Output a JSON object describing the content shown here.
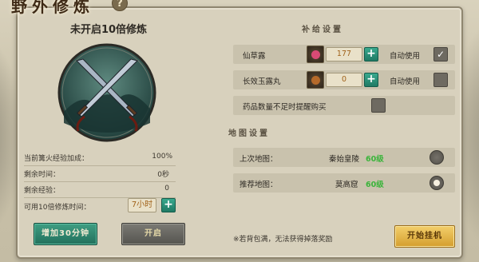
{
  "window": {
    "title": "野外修炼",
    "help_icon": "?"
  },
  "left": {
    "mode_title": "未开启10倍修炼",
    "stats": [
      {
        "label": "当前篝火经验加成：",
        "value": "100%"
      },
      {
        "label": "剩余时间：",
        "value": "0秒"
      },
      {
        "label": "剩余经验：",
        "value": "0"
      },
      {
        "label": "可用10倍修炼时间：",
        "value": "7小时"
      }
    ],
    "plus_label": "+",
    "add_button": "增加30分钟",
    "start_button": "开启"
  },
  "supply": {
    "title": "补给设置",
    "items": [
      {
        "name": "仙草露",
        "qty": "177",
        "auto_label": "自动使用",
        "checked": true,
        "gem_color": "#d94a74"
      },
      {
        "name": "长效玉露丸",
        "qty": "0",
        "auto_label": "自动使用",
        "checked": false,
        "gem_color": "#b56a2a"
      }
    ],
    "remind_label": "药品数量不足时提醒购买",
    "check_mark": "✓"
  },
  "map": {
    "title": "地图设置",
    "rows": [
      {
        "label": "上次地图：",
        "name": "秦始皇陵",
        "level": "60级",
        "selected": false
      },
      {
        "label": "推荐地图：",
        "name": "莫高窟",
        "level": "60级",
        "selected": true
      }
    ]
  },
  "note": "※若背包满，无法获得掉落奖励",
  "hangup_button": "开始挂机",
  "colors": {
    "accent_green": "#22705c",
    "gold": "#d49e2e",
    "level_green": "#3bb43b"
  }
}
